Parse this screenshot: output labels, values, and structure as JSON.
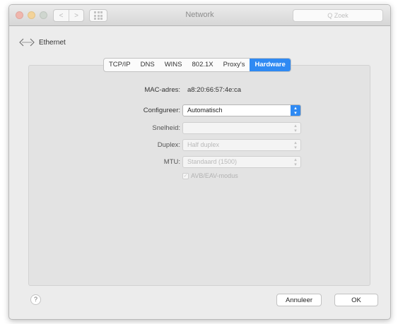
{
  "window": {
    "title": "Network",
    "search_placeholder": "Q  Zoek"
  },
  "toolbar": {
    "back_glyph": "<",
    "forward_glyph": ">"
  },
  "header": {
    "service_name": "Ethernet",
    "icon": "back-forward-arrows-icon"
  },
  "tabs": [
    {
      "label": "TCP/IP",
      "active": false
    },
    {
      "label": "DNS",
      "active": false
    },
    {
      "label": "WINS",
      "active": false
    },
    {
      "label": "802.1X",
      "active": false
    },
    {
      "label": "Proxy's",
      "active": false
    },
    {
      "label": "Hardware",
      "active": true
    }
  ],
  "hardware": {
    "mac_label": "MAC-adres:",
    "mac_value": "a8:20:66:57:4e:ca",
    "configure_label": "Configureer:",
    "configure_value": "Automatisch",
    "speed_label": "Snelheid:",
    "speed_value": "",
    "duplex_label": "Duplex:",
    "duplex_value": "Half duplex",
    "mtu_label": "MTU:",
    "mtu_value": "Standaard (1500)",
    "avb_label": "AVB/EAV-modus",
    "avb_checked": false
  },
  "footer": {
    "help_glyph": "?",
    "cancel_label": "Annuleer",
    "ok_label": "OK"
  },
  "colors": {
    "accent": "#2f8af3",
    "window_bg": "#ececec",
    "panel_bg": "#e3e3e3"
  }
}
